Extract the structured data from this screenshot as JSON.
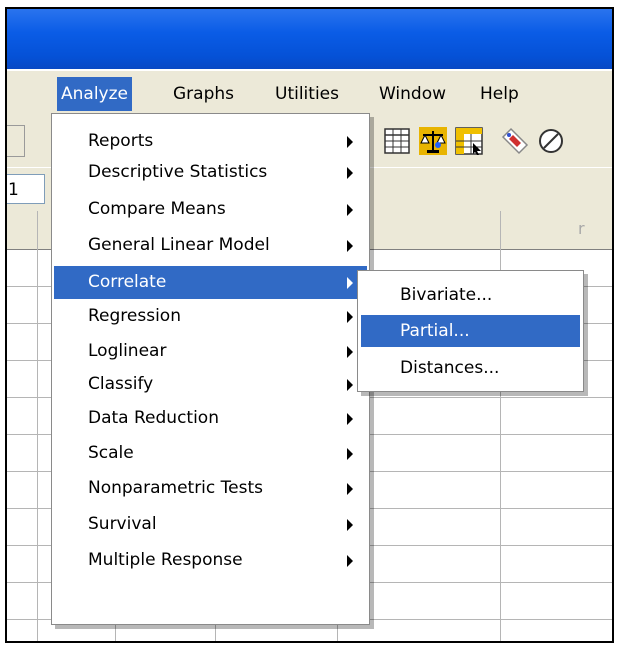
{
  "menubar": {
    "items": [
      {
        "label": "Analyze",
        "active": true
      },
      {
        "label": "Graphs",
        "active": false
      },
      {
        "label": "Utilities",
        "active": false
      },
      {
        "label": "Window",
        "active": false
      },
      {
        "label": "Help",
        "active": false
      }
    ]
  },
  "cellbar": {
    "cell_ref": "1"
  },
  "grid": {
    "column_header_fragment": "r"
  },
  "dropdown": {
    "items": [
      {
        "label": "Reports",
        "has_submenu": true
      },
      {
        "label": "Descriptive Statistics",
        "has_submenu": true
      },
      {
        "label": "Compare Means",
        "has_submenu": true
      },
      {
        "label": "General Linear Model",
        "has_submenu": true
      },
      {
        "label": "Correlate",
        "has_submenu": true,
        "active": true
      },
      {
        "label": "Regression",
        "has_submenu": true
      },
      {
        "label": "Loglinear",
        "has_submenu": true
      },
      {
        "label": "Classify",
        "has_submenu": true
      },
      {
        "label": "Data Reduction",
        "has_submenu": true
      },
      {
        "label": "Scale",
        "has_submenu": true
      },
      {
        "label": "Nonparametric Tests",
        "has_submenu": true
      },
      {
        "label": "Survival",
        "has_submenu": true
      },
      {
        "label": "Multiple Response",
        "has_submenu": true
      }
    ]
  },
  "submenu": {
    "items": [
      {
        "label": "Bivariate...",
        "active": false
      },
      {
        "label": "Partial...",
        "active": true
      },
      {
        "label": "Distances...",
        "active": false
      }
    ]
  },
  "toolbar": {
    "icons": [
      "grid-icon",
      "balance-scale-icon",
      "select-cases-icon",
      "value-labels-icon",
      "use-sets-icon"
    ]
  },
  "colors": {
    "menu_highlight": "#316ac5",
    "titlebar": "#0a5ce6",
    "chrome": "#ece9d8"
  }
}
